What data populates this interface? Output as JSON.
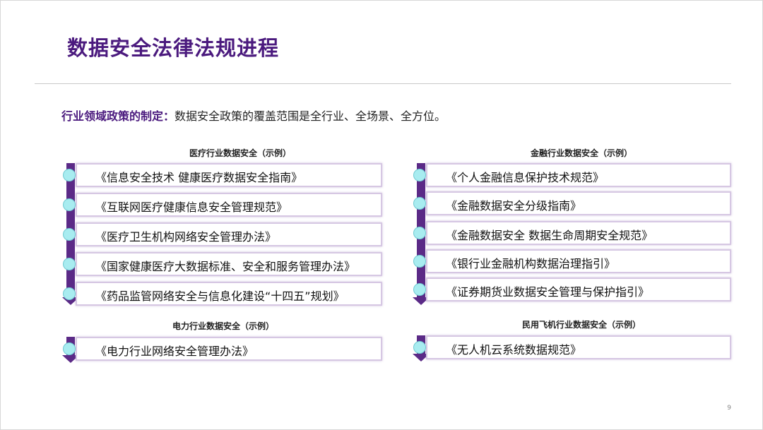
{
  "title": "数据安全法律法规进程",
  "intro": {
    "label": "行业领域政策的制定：",
    "text": "数据安全政策的覆盖范围是全行业、全场景、全方位。"
  },
  "sections": {
    "medical": {
      "title": "医疗行业数据安全（示例）",
      "items": [
        "《信息安全技术 健康医疗数据安全指南》",
        "《互联网医疗健康信息安全管理规范》",
        "《医疗卫生机构网络安全管理办法》",
        "《国家健康医疗大数据标准、安全和服务管理办法》",
        "《药品监管网络安全与信息化建设“十四五”规划》"
      ]
    },
    "finance": {
      "title": "金融行业数据安全（示例）",
      "items": [
        "《个人金融信息保护技术规范》",
        "《金融数据安全分级指南》",
        "《金融数据安全 数据生命周期安全规范》",
        "《银行业金融机构数据治理指引》",
        "《证券期货业数据安全管理与保护指引》"
      ]
    },
    "power": {
      "title": "电力行业数据安全（示例）",
      "items": [
        "《电力行业网络安全管理办法》"
      ]
    },
    "aviation": {
      "title": "民用飞机行业数据安全（示例）",
      "items": [
        "《无人机云系统数据规范》"
      ]
    }
  },
  "page_number": "9",
  "colors": {
    "accent_purple": "#5b2a87",
    "title_purple": "#4b1a7e",
    "dot_cyan": "#a8ecf0",
    "box_border": "#d6c7e3"
  }
}
